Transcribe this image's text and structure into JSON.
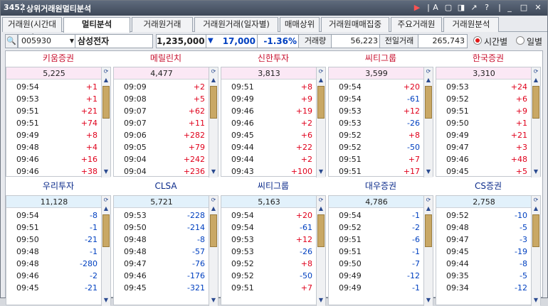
{
  "title": {
    "code": "3452",
    "name": "상위거래원멀티분석"
  },
  "tabs": [
    "거래원(시간대별)",
    "멀티분석",
    "거래원거래",
    "거래원거래(일자별)",
    "매매상위",
    "거래원매매집중",
    "주요거래원",
    "거래원분석"
  ],
  "active_tab": 1,
  "controls": {
    "stock_code": "005930",
    "stock_name": "삼성전자",
    "price": "1,235,000",
    "change_icon": "down-triangle-icon",
    "change": "17,000",
    "change_pct": "-1.36%",
    "volume_label": "거래량",
    "volume": "56,223",
    "prev_label": "전일거래",
    "prev_volume": "265,743",
    "radio_time": "시간별",
    "radio_day": "일별",
    "selected_radio": "시간별"
  },
  "colors": {
    "up": "#e0001b",
    "down": "#0040c0",
    "sell_header": "#c8102e",
    "buy_header": "#0a2a8a"
  },
  "top_panels": [
    {
      "broker": "키움증권",
      "total": "5,225",
      "rows": [
        [
          "09:54",
          "+1"
        ],
        [
          "09:53",
          "+1"
        ],
        [
          "09:51",
          "+21"
        ],
        [
          "09:51",
          "+74"
        ],
        [
          "09:49",
          "+8"
        ],
        [
          "09:48",
          "+4"
        ],
        [
          "09:46",
          "+16"
        ],
        [
          "09:46",
          "+38"
        ]
      ]
    },
    {
      "broker": "메릴린치",
      "total": "4,477",
      "rows": [
        [
          "09:09",
          "+2"
        ],
        [
          "09:08",
          "+5"
        ],
        [
          "09:07",
          "+62"
        ],
        [
          "09:07",
          "+11"
        ],
        [
          "09:06",
          "+282"
        ],
        [
          "09:05",
          "+79"
        ],
        [
          "09:04",
          "+242"
        ],
        [
          "09:04",
          "+236"
        ]
      ]
    },
    {
      "broker": "신한투자",
      "total": "3,813",
      "rows": [
        [
          "09:51",
          "+8"
        ],
        [
          "09:49",
          "+9"
        ],
        [
          "09:46",
          "+19"
        ],
        [
          "09:46",
          "+2"
        ],
        [
          "09:45",
          "+6"
        ],
        [
          "09:44",
          "+22"
        ],
        [
          "09:44",
          "+2"
        ],
        [
          "09:43",
          "+100"
        ]
      ]
    },
    {
      "broker": "씨티그룹",
      "total": "3,599",
      "rows": [
        [
          "09:54",
          "+20"
        ],
        [
          "09:54",
          "-61"
        ],
        [
          "09:53",
          "+12"
        ],
        [
          "09:53",
          "-26"
        ],
        [
          "09:52",
          "+8"
        ],
        [
          "09:52",
          "-50"
        ],
        [
          "09:51",
          "+7"
        ],
        [
          "09:51",
          "+17"
        ]
      ]
    },
    {
      "broker": "한국증권",
      "total": "3,310",
      "rows": [
        [
          "09:53",
          "+24"
        ],
        [
          "09:52",
          "+6"
        ],
        [
          "09:51",
          "+9"
        ],
        [
          "09:50",
          "+1"
        ],
        [
          "09:49",
          "+21"
        ],
        [
          "09:47",
          "+3"
        ],
        [
          "09:46",
          "+48"
        ],
        [
          "09:45",
          "+5"
        ]
      ]
    }
  ],
  "bottom_panels": [
    {
      "broker": "우리투자",
      "total": "11,128",
      "rows": [
        [
          "09:54",
          "-8"
        ],
        [
          "09:51",
          "-1"
        ],
        [
          "09:50",
          "-21"
        ],
        [
          "09:48",
          "-1"
        ],
        [
          "09:48",
          "-280"
        ],
        [
          "09:46",
          "-2"
        ],
        [
          "09:45",
          "-21"
        ]
      ]
    },
    {
      "broker": "CLSA",
      "total": "5,721",
      "rows": [
        [
          "09:53",
          "-228"
        ],
        [
          "09:50",
          "-214"
        ],
        [
          "09:48",
          "-8"
        ],
        [
          "09:48",
          "-57"
        ],
        [
          "09:47",
          "-76"
        ],
        [
          "09:46",
          "-176"
        ],
        [
          "09:45",
          "-321"
        ]
      ]
    },
    {
      "broker": "씨티그룹",
      "total": "5,163",
      "rows": [
        [
          "09:54",
          "+20"
        ],
        [
          "09:54",
          "-61"
        ],
        [
          "09:53",
          "+12"
        ],
        [
          "09:53",
          "-26"
        ],
        [
          "09:52",
          "+8"
        ],
        [
          "09:52",
          "-50"
        ],
        [
          "09:51",
          "+7"
        ]
      ]
    },
    {
      "broker": "대우증권",
      "total": "4,786",
      "rows": [
        [
          "09:54",
          "-1"
        ],
        [
          "09:52",
          "-2"
        ],
        [
          "09:51",
          "-6"
        ],
        [
          "09:51",
          "-1"
        ],
        [
          "09:50",
          "-7"
        ],
        [
          "09:49",
          "-12"
        ],
        [
          "09:49",
          "-1"
        ]
      ]
    },
    {
      "broker": "CS증권",
      "total": "2,758",
      "rows": [
        [
          "09:52",
          "-10"
        ],
        [
          "09:48",
          "-5"
        ],
        [
          "09:47",
          "-3"
        ],
        [
          "09:45",
          "-19"
        ],
        [
          "09:44",
          "-8"
        ],
        [
          "09:35",
          "-5"
        ],
        [
          "09:34",
          "-12"
        ]
      ]
    }
  ]
}
